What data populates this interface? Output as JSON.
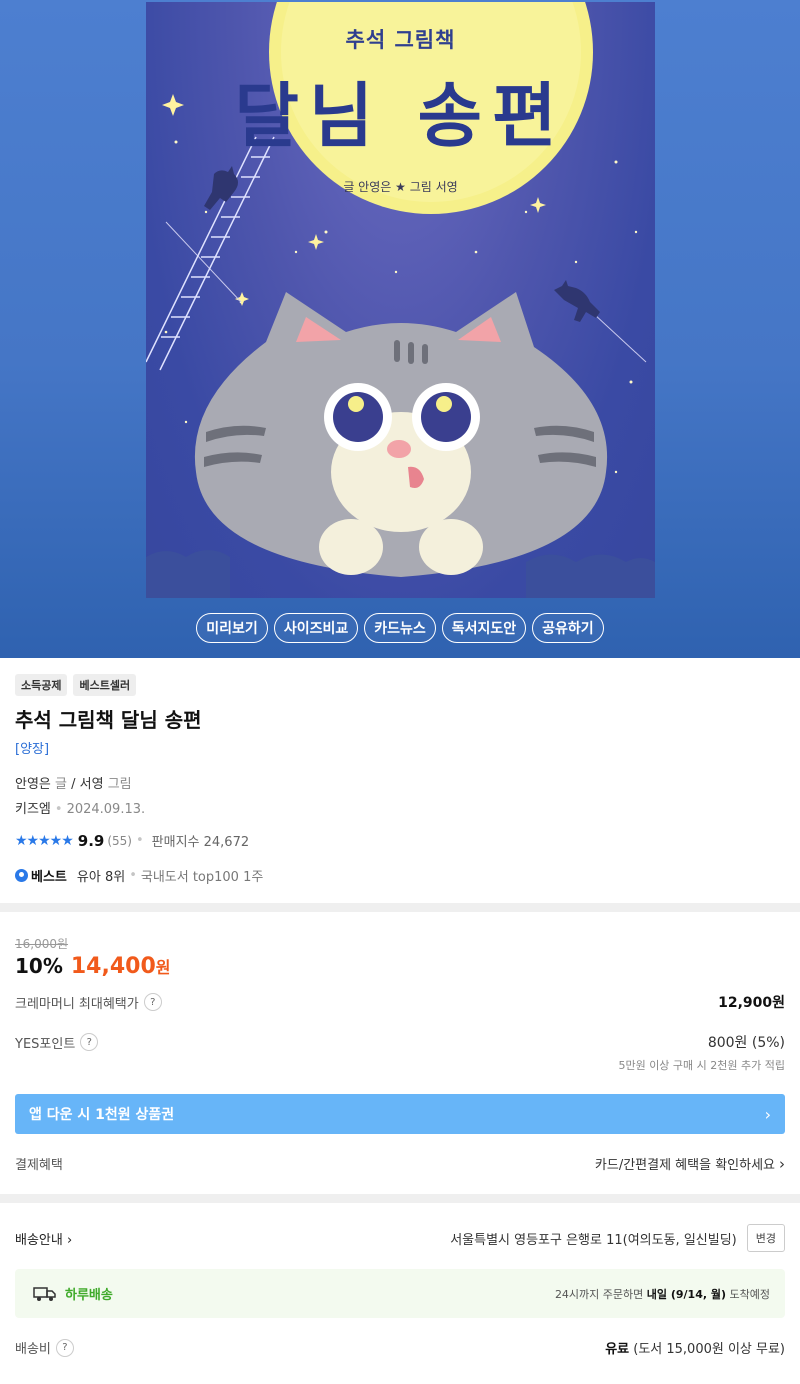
{
  "cover": {
    "series": "추석 그림책",
    "title": "달님 송편",
    "credit": "글 안영은 ★ 그림 서영"
  },
  "hero_buttons": [
    "미리보기",
    "사이즈비교",
    "카드뉴스",
    "독서지도안",
    "공유하기"
  ],
  "badges": [
    "소득공제",
    "베스트셀러"
  ],
  "product": {
    "title": "추석 그림책 달님 송편",
    "format": "[양장]",
    "author": "안영은",
    "author_role": "글",
    "illustrator": "/ 서영",
    "illustrator_role": "그림",
    "publisher": "키즈엠",
    "date": "2024.09.13."
  },
  "rating": {
    "stars": "★★★★★",
    "score": "9.9",
    "count": "(55)",
    "sales": "판매지수 24,672"
  },
  "rank": {
    "label": "베스트",
    "category": "유아 8위",
    "extra": "국내도서 top100 1주"
  },
  "price": {
    "original": "16,000원",
    "discount_rate": "10%",
    "sale_price": "14,400",
    "won": "원",
    "benefit_label": "크레마머니 최대혜택가",
    "benefit_value": "12,900원",
    "points_label": "YES포인트",
    "points_value": "800원 (5%)",
    "points_note": "5만원 이상 구매 시 2천원 추가 적립",
    "promo": "앱 다운 시 1천원 상품권",
    "payment_label": "결제혜택",
    "payment_value": "카드/간편결제 혜택을 확인하세요"
  },
  "delivery": {
    "label": "배송안내",
    "address": "서울특별시 영등포구 은행로 11(여의도동, 일신빌딩)",
    "change": "변경",
    "oneday_label": "하루배송",
    "oneday_pre": "24시까지 주문하면",
    "oneday_date": "내일 (9/14, 월)",
    "oneday_post": "도착예정",
    "fee_label": "배송비",
    "fee_value": "유료",
    "fee_note": "(도서 15,000원 이상 무료)"
  },
  "help_glyph": "?",
  "icons": [
    "star-icon",
    "help-icon",
    "chevron-right-icon",
    "truck-icon",
    "best-badge-icon"
  ],
  "colors": {
    "hero_bg": "#4576c6",
    "accent_blue": "#2a79e8",
    "sale_orange": "#f15a1b",
    "promo_blue": "#67b5f8",
    "oneday_green": "#3faa2a"
  }
}
